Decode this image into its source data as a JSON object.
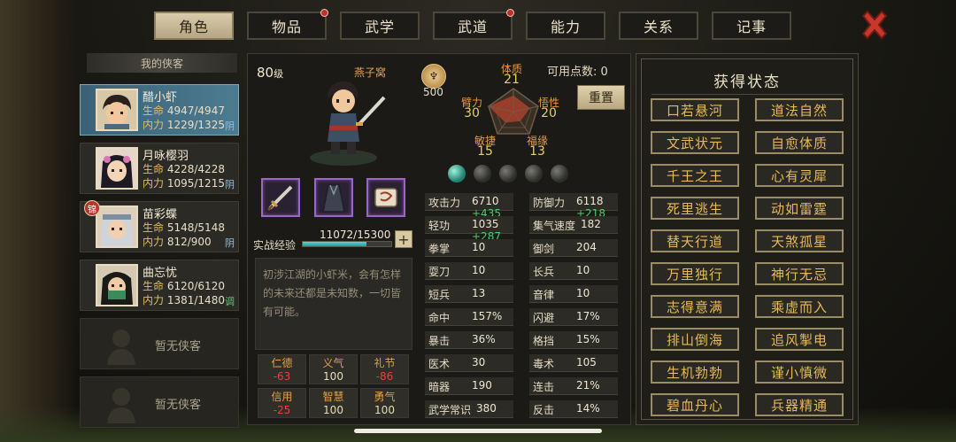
{
  "tabs": [
    {
      "label": "角色",
      "active": true,
      "dot": false
    },
    {
      "label": "物品",
      "active": false,
      "dot": true
    },
    {
      "label": "武学",
      "active": false,
      "dot": false
    },
    {
      "label": "武道",
      "active": false,
      "dot": true
    },
    {
      "label": "能力",
      "active": false,
      "dot": false
    },
    {
      "label": "关系",
      "active": false,
      "dot": false
    },
    {
      "label": "记事",
      "active": false,
      "dot": false
    }
  ],
  "close_icon": "close-x-icon",
  "list": {
    "title": "我的侠客",
    "heroes": [
      {
        "name": "醋小虾",
        "hp_label": "生命",
        "hp": "4947/4947",
        "mp_label": "内力",
        "mp": "1229/1325",
        "tag": "阴",
        "selected": true,
        "badge": ""
      },
      {
        "name": "月咏樱羽",
        "hp_label": "生命",
        "hp": "4228/4228",
        "mp_label": "内力",
        "mp": "1095/1215",
        "tag": "阴",
        "selected": false,
        "badge": ""
      },
      {
        "name": "苗彩蝶",
        "hp_label": "生命",
        "hp": "5148/5148",
        "mp_label": "内力",
        "mp": "812/900",
        "tag": "阴",
        "selected": false,
        "badge": "锦"
      },
      {
        "name": "曲忘忧",
        "hp_label": "生命",
        "hp": "6120/6120",
        "mp_label": "内力",
        "mp": "1381/1480",
        "tag": "调",
        "selected": false,
        "badge": ""
      }
    ],
    "empty": [
      "暂无侠客",
      "暂无侠客"
    ]
  },
  "profile": {
    "level": "80",
    "level_unit": "级",
    "home": "燕子窝",
    "rank_value": "500",
    "rank_icon": "rank-medal-icon",
    "points_label": "可用点数:",
    "points": "0",
    "reset": "重置",
    "radar": {
      "体质": "21",
      "悟性": "20",
      "福缘": "13",
      "敏捷": "15",
      "臂力": "30"
    },
    "radar_labels": {
      "top": "体质",
      "right": "悟性",
      "br": "福缘",
      "bl": "敏捷",
      "left": "臂力"
    },
    "equipment_icons": [
      "sword-icon",
      "cloak-icon",
      "scroll-icon"
    ],
    "exp_label": "实战经验",
    "exp_text": "11072/15300",
    "exp_fraction": 0.7237,
    "desc": "初涉江湖的小虾米，会有怎样的未来还都是未知数，一切皆有可能。"
  },
  "virtues": [
    {
      "name": "仁德",
      "value": "-63",
      "neg": true
    },
    {
      "name": "义气",
      "value": "100",
      "neg": false
    },
    {
      "name": "礼节",
      "value": "-86",
      "neg": true
    },
    {
      "name": "信用",
      "value": "-25",
      "neg": true
    },
    {
      "name": "智慧",
      "value": "100",
      "neg": false
    },
    {
      "name": "勇气",
      "value": "100",
      "neg": false
    }
  ],
  "orbs": [
    true,
    false,
    false,
    false,
    false
  ],
  "stats": [
    {
      "k": "攻击力",
      "v": "6710",
      "p": "+435"
    },
    {
      "k": "防御力",
      "v": "6118",
      "p": "+218"
    },
    {
      "k": "轻功",
      "v": "1035",
      "p": "+287"
    },
    {
      "k": "集气速度",
      "v": "182",
      "p": ""
    },
    {
      "k": "拳掌",
      "v": "10",
      "p": ""
    },
    {
      "k": "御剑",
      "v": "204",
      "p": ""
    },
    {
      "k": "耍刀",
      "v": "10",
      "p": ""
    },
    {
      "k": "长兵",
      "v": "10",
      "p": ""
    },
    {
      "k": "短兵",
      "v": "13",
      "p": ""
    },
    {
      "k": "音律",
      "v": "10",
      "p": ""
    },
    {
      "k": "命中",
      "v": "157%",
      "p": ""
    },
    {
      "k": "闪避",
      "v": "17%",
      "p": ""
    },
    {
      "k": "暴击",
      "v": "36%",
      "p": ""
    },
    {
      "k": "格挡",
      "v": "15%",
      "p": ""
    },
    {
      "k": "医术",
      "v": "30",
      "p": ""
    },
    {
      "k": "毒术",
      "v": "105",
      "p": ""
    },
    {
      "k": "暗器",
      "v": "190",
      "p": ""
    },
    {
      "k": "连击",
      "v": "21%",
      "p": ""
    },
    {
      "k": "武学常识",
      "v": "380",
      "p": ""
    },
    {
      "k": "反击",
      "v": "14%",
      "p": ""
    }
  ],
  "status": {
    "title": "获得状态",
    "items": [
      "口若悬河",
      "道法自然",
      "文武状元",
      "自愈体质",
      "千王之王",
      "心有灵犀",
      "死里逃生",
      "动如雷霆",
      "替天行道",
      "天煞孤星",
      "万里独行",
      "神行无忌",
      "志得意满",
      "乘虚而入",
      "排山倒海",
      "追风掣电",
      "生机勃勃",
      "谨小慎微",
      "碧血丹心",
      "兵器精通"
    ]
  }
}
